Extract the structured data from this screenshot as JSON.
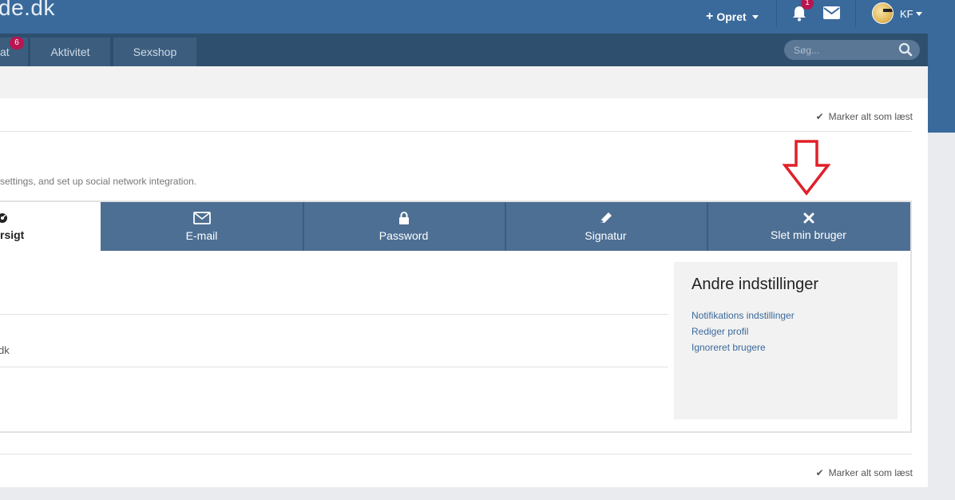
{
  "header": {
    "logo_text": "de.dk",
    "create_label": "Opret",
    "notification_count": "1",
    "user_initials": "KF"
  },
  "nav": {
    "tabs": [
      {
        "label": "at",
        "badge": "6"
      },
      {
        "label": "Aktivitet"
      },
      {
        "label": "Sexshop"
      }
    ],
    "search_placeholder": "Søg..."
  },
  "page": {
    "mark_all_read": "Marker alt som læst",
    "title_fragment": "-",
    "description": "settings, and set up social network integration.",
    "tabs": [
      {
        "label": "rsigt",
        "icon": "dashboard-icon",
        "active": true
      },
      {
        "label": "E-mail",
        "icon": "envelope-icon"
      },
      {
        "label": "Password",
        "icon": "lock-icon"
      },
      {
        "label": "Signatur",
        "icon": "pencil-icon"
      },
      {
        "label": "Slet min bruger",
        "icon": "close-icon"
      }
    ],
    "email_fragment": "dk",
    "side_panel": {
      "title": "Andre indstillinger",
      "links": [
        "Notifikations indstillinger",
        "Rediger profil",
        "Ignoreret brugere"
      ]
    }
  },
  "colors": {
    "header_blue": "#3a6a9b",
    "nav_dark": "#2f4f6f",
    "tab_blue": "#4d6f93",
    "badge": "#b91650",
    "annotation_arrow": "#e0202a"
  }
}
